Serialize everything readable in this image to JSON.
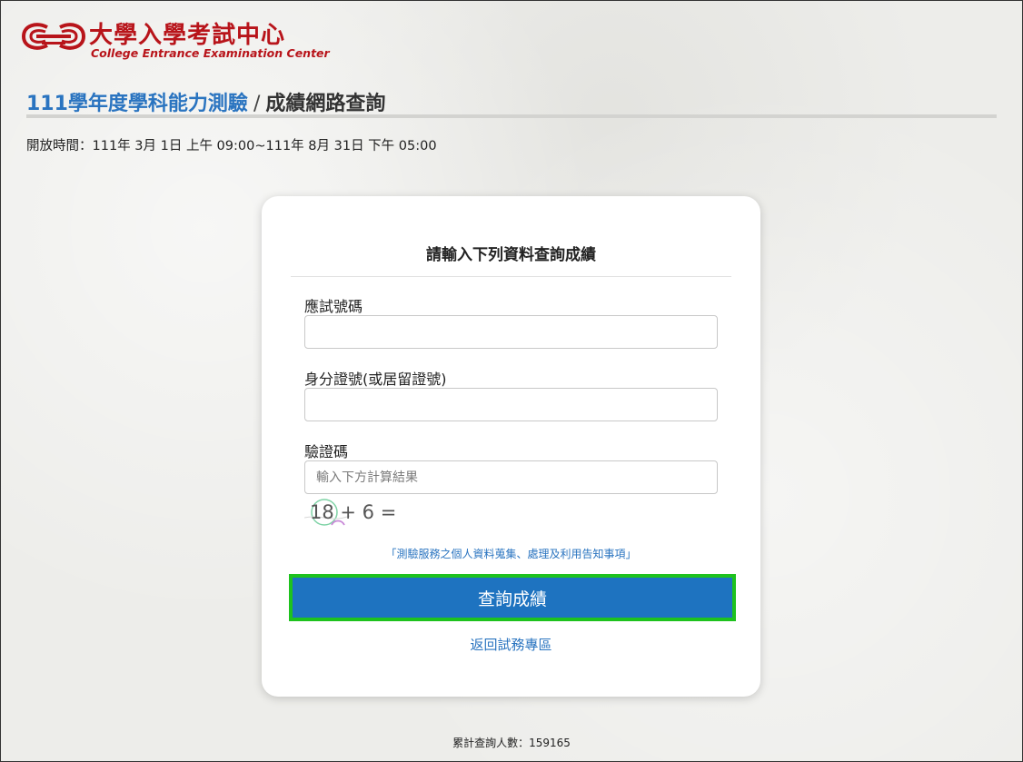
{
  "brand": {
    "name_zh": "大學入學考試中心",
    "name_en": "College Entrance Examination Center",
    "color": "#b8141a",
    "logo_icon": "ceec-logo-icon"
  },
  "heading": {
    "exam_name": "111學年度學科能力測驗",
    "separator": "/",
    "subtitle": "成績網路查詢",
    "accent_color": "#2a74c0"
  },
  "open_time": "開放時間：111年 3月 1日 上午 09:00~111年 8月 31日 下午 05:00",
  "form": {
    "title": "請輸入下列資料查詢成績",
    "fields": [
      {
        "label": "應試號碼",
        "value": "",
        "placeholder": ""
      },
      {
        "label": "身分證號(或居留證號)",
        "value": "",
        "placeholder": ""
      },
      {
        "label": "驗證碼",
        "value": "",
        "placeholder": "輸入下方計算結果"
      }
    ],
    "captcha_text": "18 + 6 =",
    "privacy_link": "「測驗服務之個人資料蒐集、處理及利用告知事項」",
    "submit_label": "查詢成績",
    "submit_color": "#1e73c0",
    "highlight_color": "#1ec21e",
    "back_link": "返回試務專區"
  },
  "footer": {
    "counter": "累計查詢人數：159165"
  }
}
